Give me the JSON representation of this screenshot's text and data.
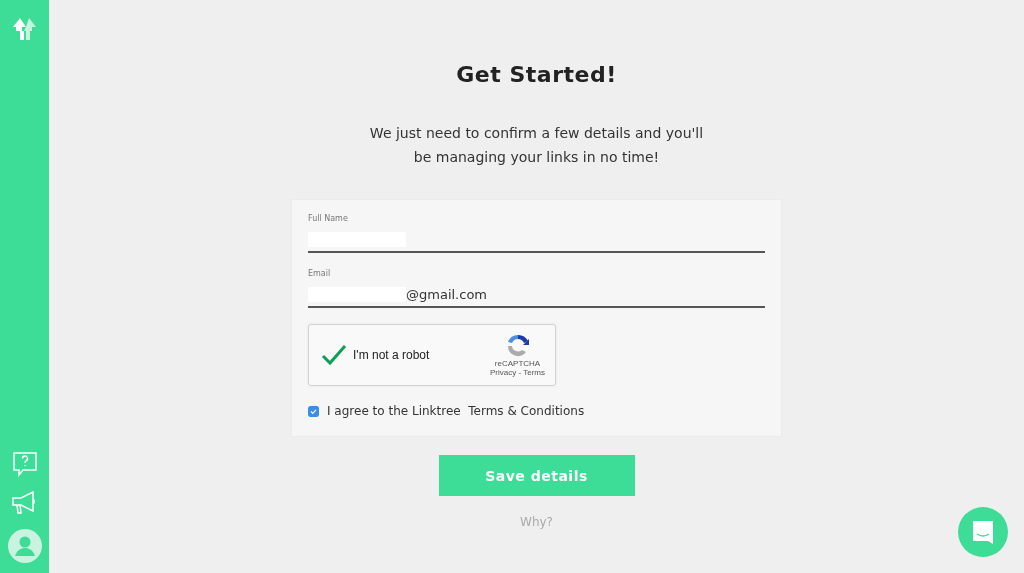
{
  "title": "Get Started!",
  "subtitle": "We just need to confirm a few details and you'll be managing your links in no time!",
  "fields": [
    {
      "label": "Full Name"
    },
    {
      "label": "Email",
      "value": "@gmail.com"
    }
  ],
  "captcha": {
    "label": "I'm not a robot",
    "checked": true,
    "brand": "reCAPTCHA",
    "links": "Privacy - Terms"
  },
  "agree": {
    "label": "I agree to the Linktree  Terms & Conditions",
    "checked": true
  },
  "save_button": "Save details",
  "why_link": "Why?"
}
